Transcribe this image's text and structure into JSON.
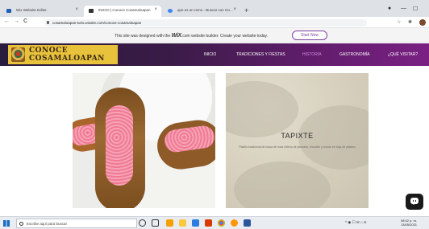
{
  "browser": {
    "tabs": [
      {
        "label": "Wix Website Editor",
        "favicon_color": "#1e5fb8"
      },
      {
        "label": "INICIO | Conoce Cosamaloapan",
        "favicon_color": "#333333"
      },
      {
        "label": "que es un remo - Buscar con Go...",
        "favicon_color": "#4285f4"
      }
    ],
    "new_tab_glyph": "+",
    "url": "cosamaloapan-turis.wixsite.com/conoce-cosamaloapan",
    "nav": {
      "back": "←",
      "forward": "→",
      "reload": "C",
      "home": "⌂"
    },
    "window_controls": {
      "minimize": "—",
      "maximize": "☐"
    }
  },
  "wix_banner": {
    "text_before": "This site was designed with the",
    "brand": "WiX",
    "text_after": ".com website builder. Create your website today.",
    "cta": "Start Now"
  },
  "site": {
    "logo_line1": "CONOCE",
    "logo_line2": "COSAMALOAPAN",
    "menu": [
      {
        "label": "INICIO",
        "active": false
      },
      {
        "label": "TRADICIONES Y FIESTAS",
        "active": false
      },
      {
        "label": "HISTORIA",
        "active": true
      },
      {
        "label": "GASTRONOMÍA",
        "active": false
      },
      {
        "label": "¿QUÉ VISITAR?",
        "active": false
      }
    ]
  },
  "cards": [
    {
      "type": "image",
      "subject": "pink-filled-pastries"
    },
    {
      "type": "image-with-text",
      "title": "TAPIXTE",
      "description": "Platillo tradicional de masa de maíz relleno de pescado, envuelto y cocido en hoja de plátano."
    }
  ],
  "taskbar": {
    "search_placeholder": "Escribe aquí para buscar",
    "tray_text": "^ ◉ ☐ ✉ ⌂ ⊙",
    "time": "08:02 p. m.",
    "date": "13/05/2021"
  },
  "colors": {
    "header_gradient_start": "#2a1c3c",
    "header_gradient_end": "#7a2083",
    "logo_bg": "#e9c23b",
    "active_menu": "#d48be0",
    "wix_accent": "#7b3fa0"
  }
}
